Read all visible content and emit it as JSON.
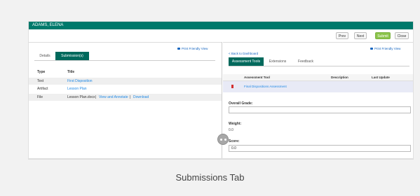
{
  "window": {
    "student_name": "ADAMS, ELENA"
  },
  "toolbar": {
    "prev": "Prev",
    "next": "Next",
    "submit": "Submit",
    "close": "Close"
  },
  "left_panel": {
    "print_view": "Print Friendly View",
    "tabs": [
      {
        "label": "Details"
      },
      {
        "label": "Submission(s)",
        "active": true
      }
    ],
    "table": {
      "headers": {
        "type": "Type",
        "title": "Title"
      },
      "rows": [
        {
          "type": "Text",
          "title": "First Disposition"
        },
        {
          "type": "Artifact",
          "title": "Lesson Plan"
        },
        {
          "type": "File",
          "title": "Lesson Plan.docx",
          "view": "View and Annotate",
          "download": "Download",
          "sep": "|"
        }
      ]
    }
  },
  "right_panel": {
    "print_view": "Print Friendly View",
    "back_link": "< Back to Dashboard",
    "tabs": [
      {
        "label": "Assessment Tools",
        "active": true
      },
      {
        "label": "Extensions"
      },
      {
        "label": "Feedback"
      }
    ],
    "assessment_table": {
      "headers": {
        "tool": "Assessment Tool",
        "description": "Description",
        "last_update": "Last Update"
      },
      "rows": [
        {
          "tool": "Final Dispositions Assessment"
        }
      ]
    },
    "overall_grade": {
      "label": "Overall Grade:",
      "value": ""
    },
    "weight": {
      "label": "Weight:",
      "value": "0.0"
    },
    "score": {
      "label": "Score:",
      "value": "0.0"
    }
  },
  "caption": "Submissions Tab",
  "colors": {
    "titlebar": "#00796b",
    "active_tab": "#00695c",
    "submit": "#8bc34a",
    "link": "#1e88e5"
  },
  "icons": {
    "print": "printer-icon",
    "flag": "flag-icon",
    "handle": "drag-handle-icon"
  }
}
